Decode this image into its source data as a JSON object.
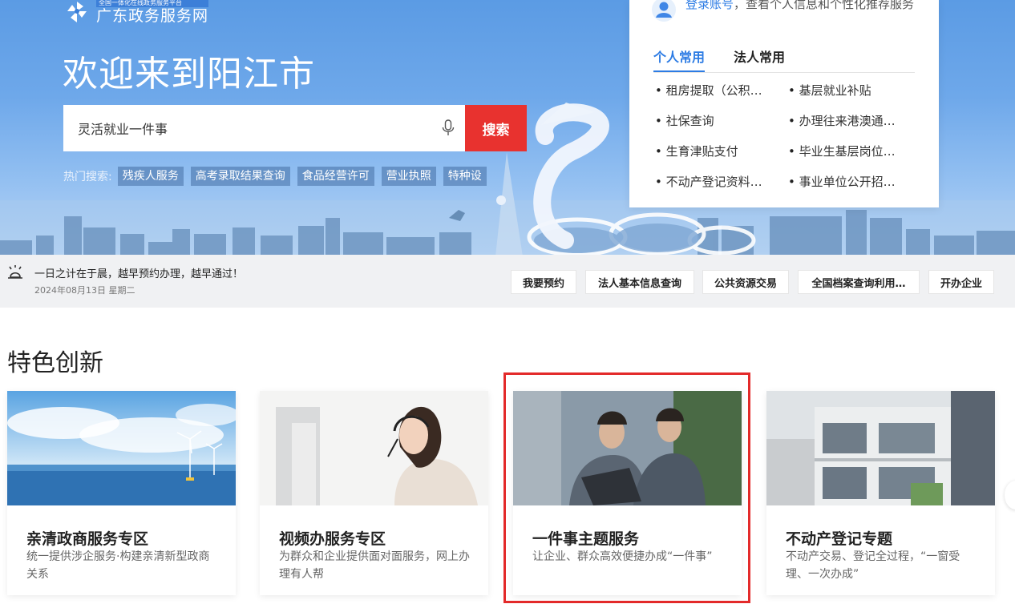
{
  "header": {
    "logo_sub": "全国一体化在线政务服务平台",
    "logo_main": "广东政务服务网",
    "welcome": "欢迎来到阳江市"
  },
  "search": {
    "value": "灵活就业一件事",
    "button_label": "搜索",
    "hot_label": "热门搜索:",
    "hot_tags": [
      "残疾人服务",
      "高考录取结果查询",
      "食品经营许可",
      "营业执照",
      "特种设"
    ]
  },
  "user_card": {
    "login_link": "登录账号",
    "login_tip": "，查看个人信息和个性化推荐服务",
    "tabs": [
      {
        "label": "个人常用",
        "active": true
      },
      {
        "label": "法人常用",
        "active": false
      }
    ],
    "items": [
      "租房提取（公积…",
      "基层就业补贴",
      "社保查询",
      "办理往来港澳通…",
      "生育津贴支付",
      "毕业生基层岗位…",
      "不动产登记资料…",
      "事业单位公开招…"
    ]
  },
  "notice": {
    "text": "一日之计在于晨，越早预约办理，越早通过！",
    "date": "2024年08月13日 星期二"
  },
  "quick_links": [
    "我要预约",
    "法人基本信息查询",
    "公共资源交易",
    "全国档案查询利用…",
    "开办企业"
  ],
  "featured": {
    "title": "特色创新",
    "cards": [
      {
        "title": "亲清政商服务专区",
        "desc": "统一提供涉企服务·构建亲清新型政商关系",
        "image": "offshore-wind-farm-image"
      },
      {
        "title": "视频办服务专区",
        "desc": "为群众和企业提供面对面服务，网上办理有人帮",
        "image": "video-service-agent-image"
      },
      {
        "title": "一件事主题服务",
        "desc": "让企业、群众高效便捷办成“一件事”",
        "image": "business-people-laptop-image",
        "highlighted": true
      },
      {
        "title": "不动产登记专题",
        "desc": "不动产交易、登记全过程，“一窗受理、一次办成”",
        "image": "residential-building-image"
      }
    ]
  },
  "colors": {
    "brand_blue": "#2d7ce4",
    "search_red": "#e8322f",
    "highlight_red": "#e32a2a",
    "hero_sky": "#6ea8ea"
  }
}
